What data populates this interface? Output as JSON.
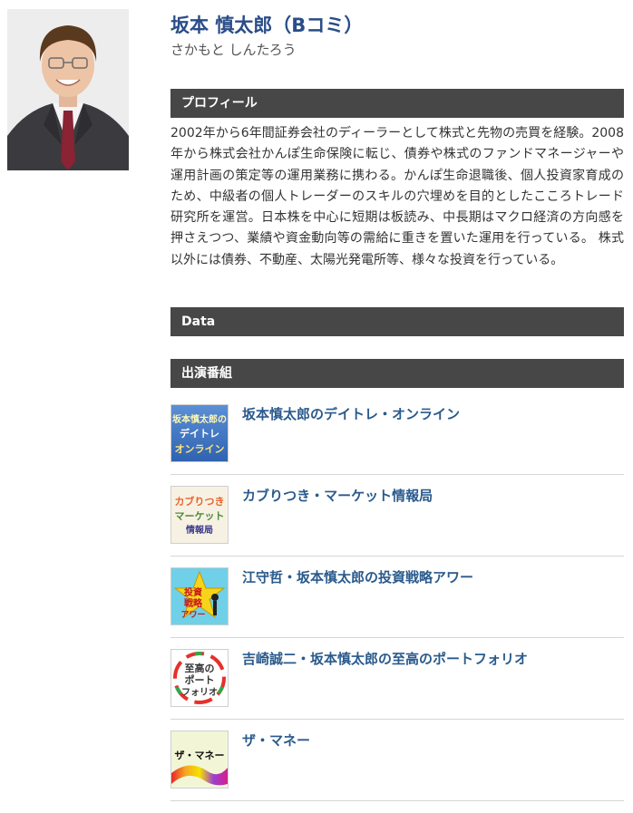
{
  "profile": {
    "name": "坂本 慎太郎（Bコミ）",
    "kana": "さかもと しんたろう"
  },
  "sections": {
    "profile_heading": "プロフィール",
    "data_heading": "Data",
    "programs_heading": "出演番組"
  },
  "bio": "2002年から6年間証券会社のディーラーとして株式と先物の売買を経験。2008年から株式会社かんぽ生命保険に転じ、債券や株式のファンドマネージャーや運用計画の策定等の運用業務に携わる。かんぽ生命退職後、個人投資家育成のため、中級者の個人トレーダーのスキルの穴埋めを目的としたこころトレード研究所を運営。日本株を中心に短期は板読み、中長期はマクロ経済の方向感を押さえつつ、業績や資金動向等の需給に重きを置いた運用を行っている。 株式以外には債券、不動産、太陽光発電所等、様々な投資を行っている。",
  "programs": [
    {
      "title": "坂本慎太郎のデイトレ・オンライン",
      "thumb_lines": [
        "坂本慎太郎の",
        "デイトレ",
        "オンライン"
      ]
    },
    {
      "title": "カブりつき・マーケット情報局",
      "thumb_lines": [
        "カブりつき",
        "マーケット",
        "情報局"
      ]
    },
    {
      "title": "江守哲・坂本慎太郎の投資戦略アワー",
      "thumb_lines": [
        "投資",
        "戦略",
        "アワー"
      ]
    },
    {
      "title": "吉崎誠二・坂本慎太郎の至高のポートフォリオ",
      "thumb_lines": [
        "至高の",
        "ポート",
        "フォリオ"
      ]
    },
    {
      "title": "ザ・マネー",
      "thumb_lines": [
        "ザ・マネー"
      ]
    }
  ]
}
